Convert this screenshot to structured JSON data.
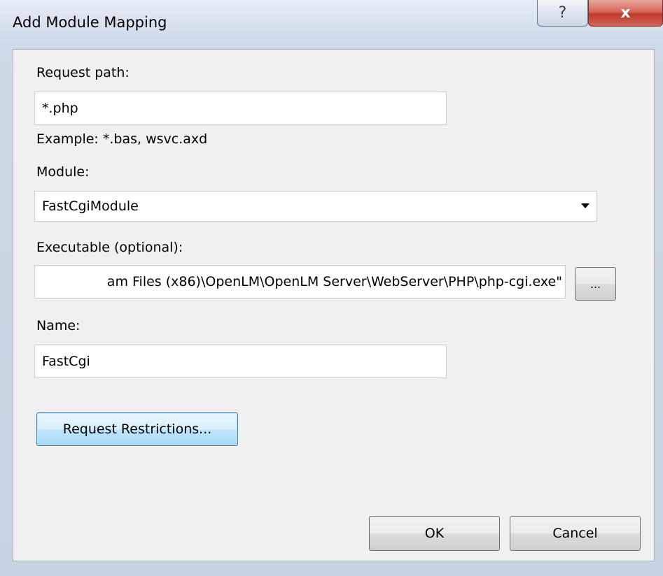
{
  "dialog": {
    "title": "Add Module Mapping",
    "help_glyph": "?",
    "close_glyph": "x"
  },
  "request_path": {
    "label": "Request path:",
    "value": "*.php",
    "example": "Example: *.bas, wsvc.axd"
  },
  "module": {
    "label": "Module:",
    "selected": "FastCgiModule"
  },
  "executable": {
    "label": "Executable (optional):",
    "value": "am Files (x86)\\OpenLM\\OpenLM Server\\WebServer\\PHP\\php-cgi.exe\"",
    "browse_label": "..."
  },
  "name": {
    "label": "Name:",
    "value": "FastCgi"
  },
  "buttons": {
    "request_restrictions": "Request Restrictions...",
    "ok": "OK",
    "cancel": "Cancel"
  }
}
